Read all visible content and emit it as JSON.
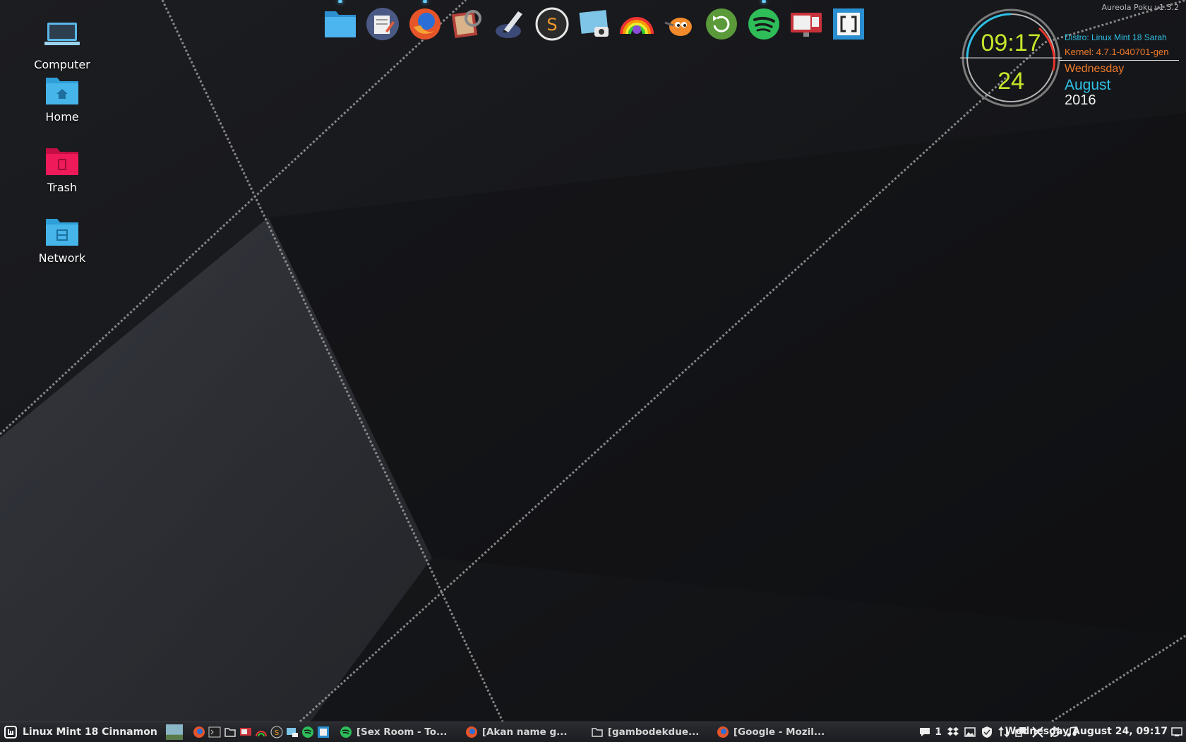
{
  "desktop": {
    "icons": [
      {
        "label": "Computer",
        "icon": "computer-icon"
      },
      {
        "label": "Home",
        "icon": "home-folder-icon"
      },
      {
        "label": "Trash",
        "icon": "trash-folder-icon"
      },
      {
        "label": "Network",
        "icon": "network-folder-icon"
      }
    ]
  },
  "dock": {
    "items": [
      "files",
      "text-editor",
      "firefox",
      "image-viewer",
      "inkscape",
      "sublime-text",
      "screenshot",
      "color-picker",
      "gimp",
      "updater",
      "spotify",
      "screen-recorder",
      "brackets"
    ]
  },
  "conky": {
    "version": "Aureola Poku v1.3.2",
    "time": "09:17",
    "day": "24",
    "distro": "Distro: Linux Mint 18 Sarah",
    "kernel": "Kernel: 4.7.1-040701-gen",
    "weekday": "Wednesday",
    "month": "August",
    "year": "2016"
  },
  "taskbar": {
    "menu_label": "Linux Mint 18 Cinnamon",
    "windows": [
      {
        "title": "[Sex Room - To...",
        "icon": "spotify-icon"
      },
      {
        "title": "[Akan name g...",
        "icon": "firefox-icon"
      },
      {
        "title": "[gambodekdue...",
        "icon": "folder-icon"
      },
      {
        "title": "[Google - Mozil...",
        "icon": "firefox-icon"
      }
    ],
    "notification_count": "1",
    "clock": "Wednesday August 24, 09:17"
  },
  "colors": {
    "accent_green": "#c6e52a",
    "accent_cyan": "#2fc0e6",
    "accent_orange": "#f07a2a"
  }
}
